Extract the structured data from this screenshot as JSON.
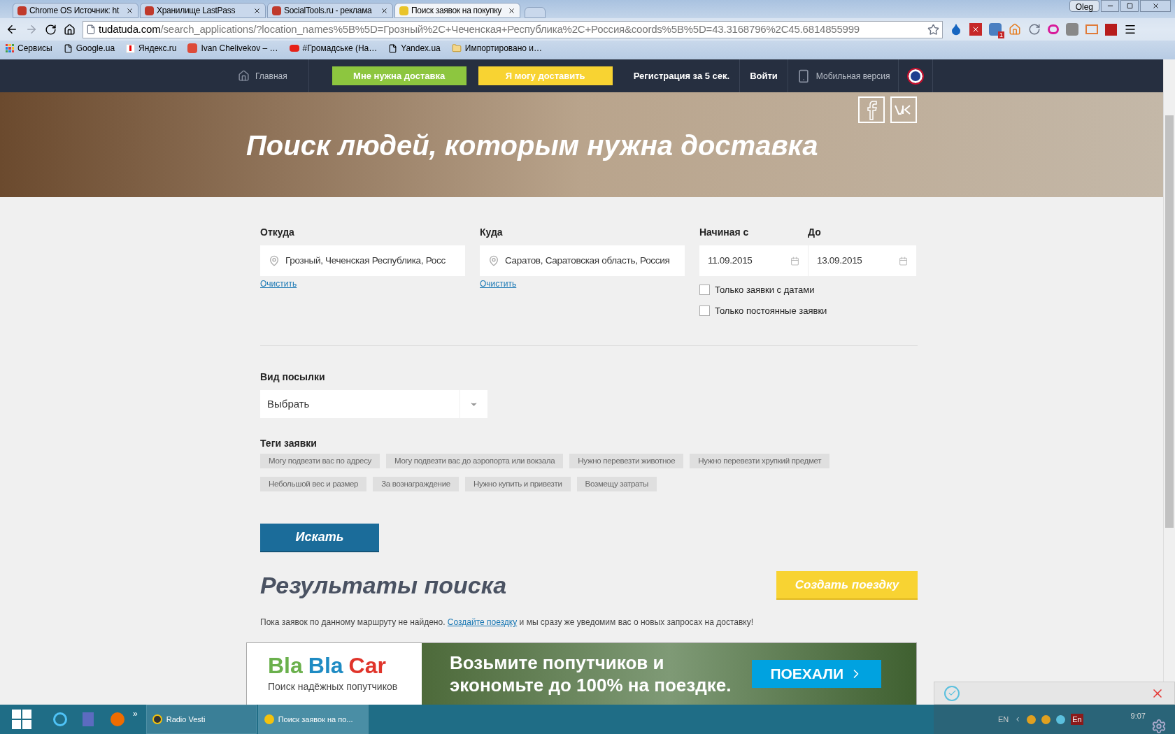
{
  "browser": {
    "tabs": [
      {
        "title": "Chrome OS Источник: ht",
        "selected": false
      },
      {
        "title": "Хранилище LastPass",
        "selected": false
      },
      {
        "title": "SocialTools.ru - реклама",
        "selected": false
      },
      {
        "title": "Поиск заявок на покупку",
        "selected": true
      }
    ],
    "profile": "Oleg",
    "url": {
      "host": "tudatuda.com",
      "path": "/search_applications/?location_names%5B%5D=Грозный%2C+Чеченская+Республика%2C+Россия&coords%5B%5D=43.3168796%2C45.6814855999"
    },
    "extension_badge": "1",
    "bookmarks": [
      {
        "label": "Сервисы",
        "kind": "apps"
      },
      {
        "label": "Google.ua",
        "kind": "page"
      },
      {
        "label": "Яндекс.ru",
        "kind": "yandex"
      },
      {
        "label": "Ivan Chelivekov – …",
        "kind": "gplus"
      },
      {
        "label": "#Громадське (На…",
        "kind": "youtube"
      },
      {
        "label": "Yandex.ua",
        "kind": "page"
      },
      {
        "label": "Импортировано и…",
        "kind": "folder"
      }
    ]
  },
  "nav": {
    "home": "Главная",
    "need_delivery": "Мне нужна доставка",
    "can_deliver": "Я могу доставить",
    "register": "Регистрация за 5 сек.",
    "login": "Войти",
    "mobile": "Мобильная версия"
  },
  "hero": {
    "title": "Поиск людей, которым нужна доставка"
  },
  "form": {
    "from": {
      "label": "Откуда",
      "value": "Грозный, Чеченская Республика, Росс",
      "clear": "Очистить"
    },
    "to": {
      "label": "Куда",
      "value": "Саратов, Саратовская область, Россия",
      "clear": "Очистить"
    },
    "date_from": {
      "label": "Начиная с",
      "value": "11.09.2015"
    },
    "date_to": {
      "label": "До",
      "value": "13.09.2015"
    },
    "checkboxes": [
      {
        "label": "Только заявки с датами",
        "checked": false
      },
      {
        "label": "Только постоянные заявки",
        "checked": false
      }
    ],
    "parcel": {
      "label": "Вид посылки",
      "value": "Выбрать"
    },
    "tags": {
      "label": "Теги заявки",
      "items": [
        {
          "label": "Могу подвезти вас по адресу",
          "selected": false
        },
        {
          "label": "Могу подвезти вас до аэропорта или вокзала",
          "selected": false
        },
        {
          "label": "Нужно перевезти животное",
          "selected": false
        },
        {
          "label": "Нужно перевезти хрупкий предмет",
          "selected": false
        },
        {
          "label": "Небольшой вес и размер",
          "selected": false
        },
        {
          "label": "За вознаграждение",
          "selected": false
        },
        {
          "label": "Нужно купить и привезти",
          "selected": false
        },
        {
          "label": "Возмещу затраты",
          "selected": false
        }
      ]
    },
    "search_button": "Искать"
  },
  "results": {
    "title": "Результаты поиска",
    "create_button": "Создать поездку",
    "message_before": "Пока заявок по данному маршруту не найдено.",
    "message_link": "Создайте поездку",
    "message_after": "и мы сразу же уведомим вас о новых запросах на доставку!"
  },
  "banner": {
    "logo": [
      "Bla",
      "Bla",
      "Car"
    ],
    "tagline": "Поиск надёжных попутчиков",
    "headline": [
      "Возьмите попутчиков и",
      "экономьте до 100% на поездке."
    ],
    "button": "ПОЕХАЛИ"
  },
  "taskbar": {
    "more": "»",
    "windows": [
      {
        "title": "Radio Vesti",
        "selected": false
      },
      {
        "title": "Поиск заявок на по...",
        "selected": true
      }
    ],
    "tray": {
      "lang": "EN",
      "keyboard": "En",
      "time": "9:07"
    }
  }
}
